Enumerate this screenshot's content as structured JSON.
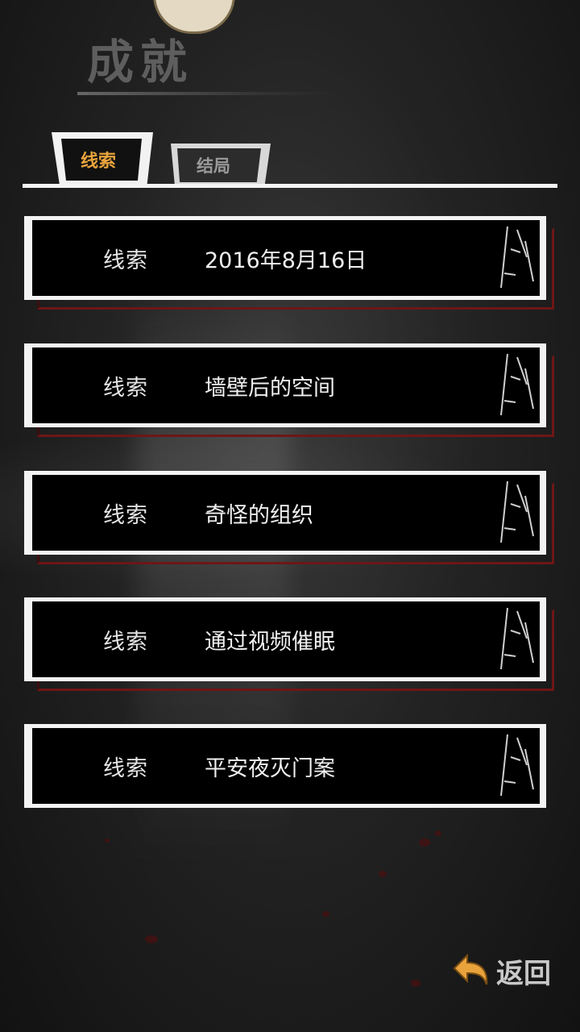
{
  "page": {
    "title": "成就"
  },
  "tabs": [
    {
      "label": "线索",
      "active": true
    },
    {
      "label": "结局",
      "active": false
    }
  ],
  "entries": [
    {
      "kind": "线索",
      "name": "2016年8月16日"
    },
    {
      "kind": "线索",
      "name": "墙壁后的空间"
    },
    {
      "kind": "线索",
      "name": "奇怪的组织"
    },
    {
      "kind": "线索",
      "name": "通过视频催眠"
    },
    {
      "kind": "线索",
      "name": "平安夜灭门案"
    }
  ],
  "footer": {
    "back_label": "返回",
    "back_icon": "return-arrow-icon"
  },
  "colors": {
    "active_tab": "#e8a33c",
    "inactive_tab": "#9a9a9a",
    "card_shadow": "#6e1616"
  }
}
